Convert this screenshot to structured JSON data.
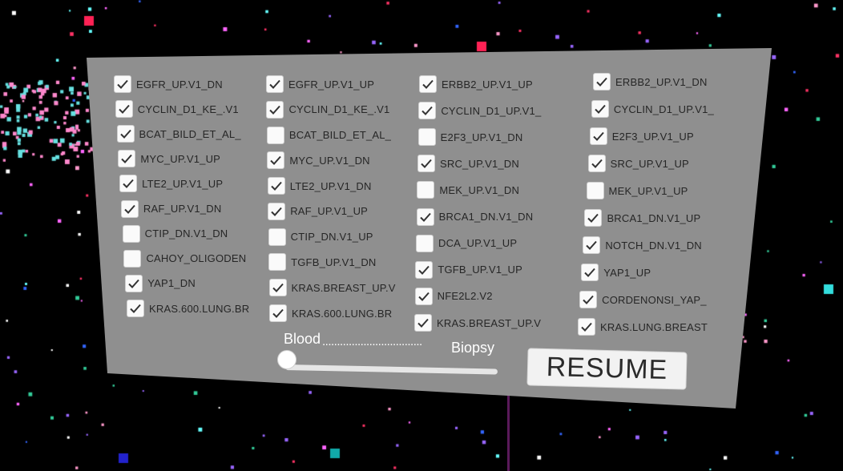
{
  "columns": [
    {
      "items": [
        {
          "label": "EGFR_UP.V1_DN",
          "checked": true
        },
        {
          "label": "CYCLIN_D1_KE_.V1",
          "checked": true
        },
        {
          "label": "BCAT_BILD_ET_AL_",
          "checked": true
        },
        {
          "label": "MYC_UP.V1_UP",
          "checked": true
        },
        {
          "label": "LTE2_UP.V1_UP",
          "checked": true
        },
        {
          "label": "RAF_UP.V1_DN",
          "checked": true
        },
        {
          "label": "CTIP_DN.V1_DN",
          "checked": false
        },
        {
          "label": "CAHOY_OLIGODEN",
          "checked": false
        },
        {
          "label": "YAP1_DN",
          "checked": true
        },
        {
          "label": "KRAS.600.LUNG.BR",
          "checked": true
        }
      ]
    },
    {
      "items": [
        {
          "label": "EGFR_UP.V1_UP",
          "checked": true
        },
        {
          "label": "CYCLIN_D1_KE_.V1",
          "checked": true
        },
        {
          "label": "BCAT_BILD_ET_AL_",
          "checked": false
        },
        {
          "label": "MYC_UP.V1_DN",
          "checked": true
        },
        {
          "label": "LTE2_UP.V1_DN",
          "checked": true
        },
        {
          "label": "RAF_UP.V1_UP",
          "checked": true
        },
        {
          "label": "CTIP_DN.V1_UP",
          "checked": false
        },
        {
          "label": "TGFB_UP.V1_DN",
          "checked": false
        },
        {
          "label": "KRAS.BREAST_UP.V",
          "checked": true
        },
        {
          "label": "KRAS.600.LUNG.BR",
          "checked": true
        }
      ]
    },
    {
      "items": [
        {
          "label": "ERBB2_UP.V1_UP",
          "checked": true
        },
        {
          "label": "CYCLIN_D1_UP.V1_",
          "checked": true
        },
        {
          "label": "E2F3_UP.V1_DN",
          "checked": false
        },
        {
          "label": "SRC_UP.V1_DN",
          "checked": true
        },
        {
          "label": "MEK_UP.V1_DN",
          "checked": false
        },
        {
          "label": "BRCA1_DN.V1_DN",
          "checked": true
        },
        {
          "label": "DCA_UP.V1_UP",
          "checked": false
        },
        {
          "label": "TGFB_UP.V1_UP",
          "checked": true
        },
        {
          "label": "NFE2L2.V2",
          "checked": true
        },
        {
          "label": "KRAS.BREAST_UP.V",
          "checked": true
        }
      ]
    },
    {
      "items": [
        {
          "label": "ERBB2_UP.V1_DN",
          "checked": true
        },
        {
          "label": "CYCLIN_D1_UP.V1_",
          "checked": true
        },
        {
          "label": "E2F3_UP.V1_UP",
          "checked": true
        },
        {
          "label": "SRC_UP.V1_UP",
          "checked": true
        },
        {
          "label": "MEK_UP.V1_UP",
          "checked": false
        },
        {
          "label": "BRCA1_DN.V1_UP",
          "checked": true
        },
        {
          "label": "NOTCH_DN.V1_DN",
          "checked": true
        },
        {
          "label": "YAP1_UP",
          "checked": true
        },
        {
          "label": "CORDENONSI_YAP_",
          "checked": true
        },
        {
          "label": "KRAS.LUNG.BREAST",
          "checked": true
        }
      ]
    }
  ],
  "slider": {
    "left_label": "Blood",
    "dots": "..................................",
    "right_label": "Biopsy",
    "value": 0
  },
  "resume_label": "RESUME"
}
